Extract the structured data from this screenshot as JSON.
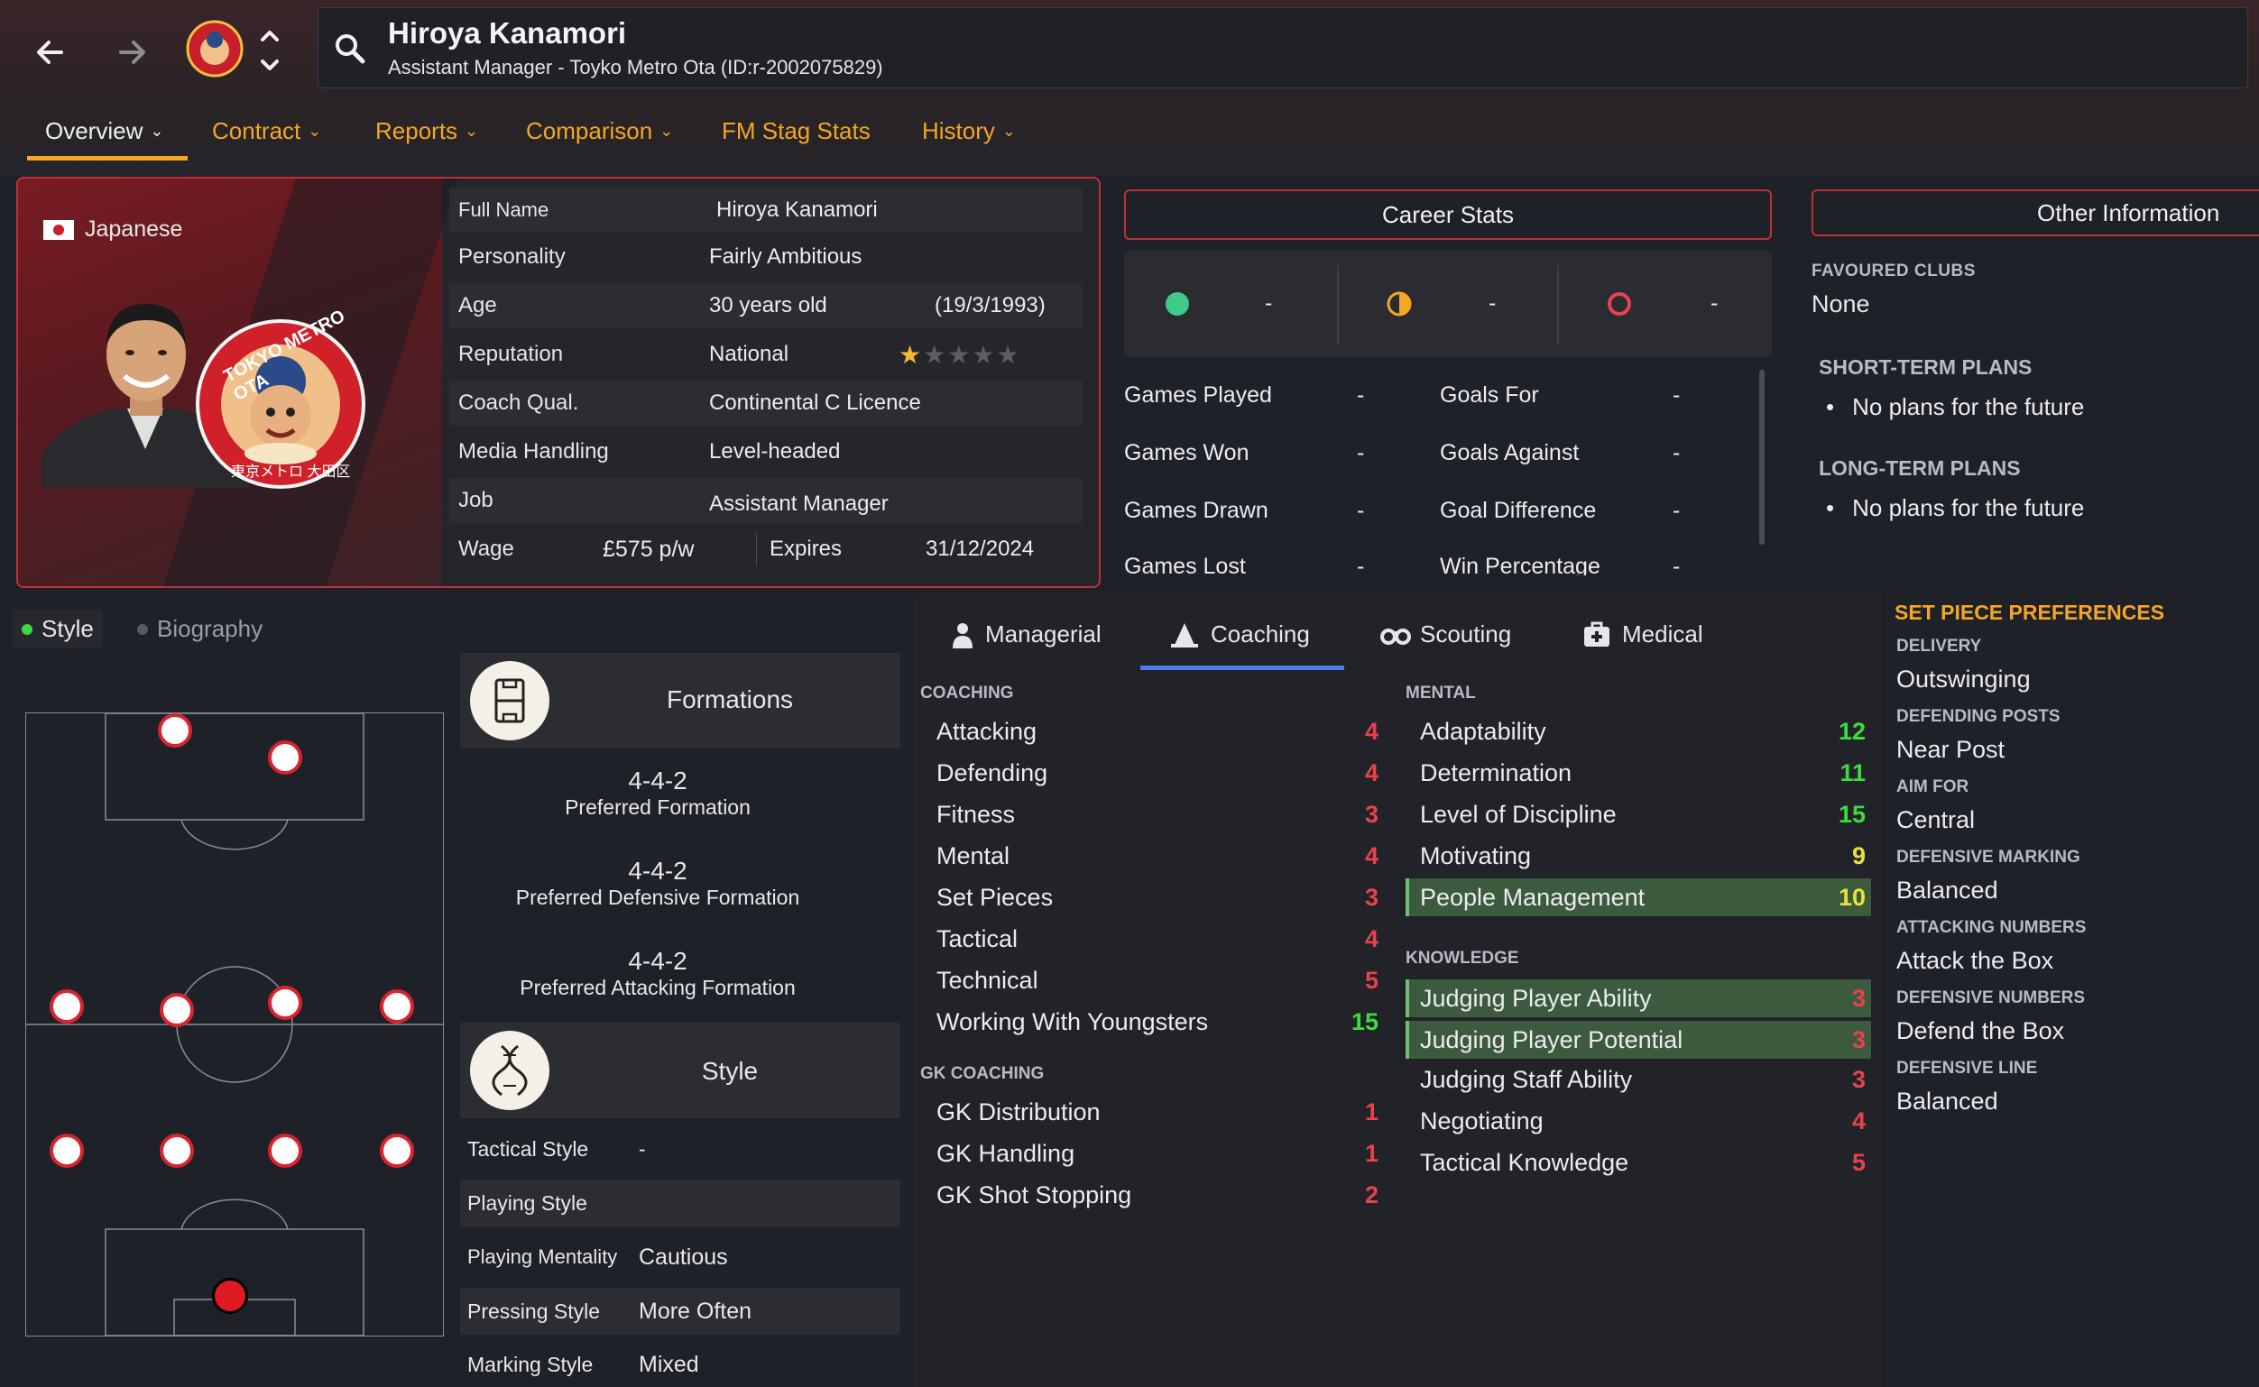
{
  "header": {
    "back_label": "Back",
    "forward_label": "Forward",
    "name": "Hiroya Kanamori",
    "subtitle": "Assistant Manager - Toyko Metro Ota (ID:r-2002075829)",
    "tabs": [
      {
        "label": "Overview",
        "has_menu": true
      },
      {
        "label": "Contract",
        "has_menu": true
      },
      {
        "label": "Reports",
        "has_menu": true
      },
      {
        "label": "Comparison",
        "has_menu": true
      },
      {
        "label": "FM Stag Stats",
        "has_menu": false
      },
      {
        "label": "History",
        "has_menu": true
      }
    ]
  },
  "profile": {
    "nationality": "Japanese",
    "badge_text_top": "TOKYO METRO OTA",
    "badge_text_bottom": "東京メトロ 大田区",
    "full_name_label": "Full Name",
    "full_name": "Hiroya Kanamori",
    "personality_label": "Personality",
    "personality": "Fairly Ambitious",
    "age_label": "Age",
    "age": "30 years old",
    "dob": "(19/3/1993)",
    "reputation_label": "Reputation",
    "reputation": "National",
    "reputation_stars": 1,
    "reputation_stars_max": 5,
    "coach_qual_label": "Coach Qual.",
    "coach_qual": "Continental C Licence",
    "media_label": "Media Handling",
    "media": "Level-headed",
    "job_label": "Job",
    "job": "Assistant Manager",
    "wage_label": "Wage",
    "wage": "£575 p/w",
    "expires_label": "Expires",
    "expires": "31/12/2024"
  },
  "career": {
    "title": "Career Stats",
    "icon_values": [
      "-",
      "-",
      "-"
    ],
    "rows": [
      {
        "l1": "Games Played",
        "v1": "-",
        "l2": "Goals For",
        "v2": "-"
      },
      {
        "l1": "Games Won",
        "v1": "-",
        "l2": "Goals Against",
        "v2": "-"
      },
      {
        "l1": "Games Drawn",
        "v1": "-",
        "l2": "Goal Difference",
        "v2": "-"
      },
      {
        "l1": "Games Lost",
        "v1": "-",
        "l2": "Win Percentage",
        "v2": "-"
      }
    ]
  },
  "other": {
    "title": "Other Information",
    "favoured_clubs_label": "FAVOURED CLUBS",
    "favoured_clubs": "None",
    "short_term_label": "SHORT-TERM PLANS",
    "short_term": "No plans for the future",
    "long_term_label": "LONG-TERM PLANS",
    "long_term": "No plans for the future"
  },
  "lower_tabs": {
    "style": "Style",
    "biography": "Biography"
  },
  "formations": {
    "title": "Formations",
    "items": [
      {
        "value": "4-4-2",
        "label": "Preferred Formation"
      },
      {
        "value": "4-4-2",
        "label": "Preferred Defensive Formation"
      },
      {
        "value": "4-4-2",
        "label": "Preferred Attacking Formation"
      }
    ]
  },
  "style": {
    "title": "Style",
    "rows": [
      {
        "label": "Tactical Style",
        "value": "-"
      },
      {
        "label": "Playing Style",
        "value": ""
      },
      {
        "label": "Playing Mentality",
        "value": "Cautious"
      },
      {
        "label": "Pressing Style",
        "value": "More Often"
      },
      {
        "label": "Marking Style",
        "value": "Mixed"
      }
    ]
  },
  "attr_tabs": [
    "Managerial",
    "Coaching",
    "Scouting",
    "Medical"
  ],
  "coaching": {
    "head": "COACHING",
    "items": [
      {
        "name": "Attacking",
        "value": "4"
      },
      {
        "name": "Defending",
        "value": "4"
      },
      {
        "name": "Fitness",
        "value": "3"
      },
      {
        "name": "Mental",
        "value": "4"
      },
      {
        "name": "Set Pieces",
        "value": "3"
      },
      {
        "name": "Tactical",
        "value": "4"
      },
      {
        "name": "Technical",
        "value": "5"
      },
      {
        "name": "Working With Youngsters",
        "value": "15"
      }
    ],
    "gk_head": "GK COACHING",
    "gk_items": [
      {
        "name": "GK Distribution",
        "value": "1"
      },
      {
        "name": "GK Handling",
        "value": "1"
      },
      {
        "name": "GK Shot Stopping",
        "value": "2"
      }
    ]
  },
  "mental": {
    "head": "MENTAL",
    "items": [
      {
        "name": "Adaptability",
        "value": "12"
      },
      {
        "name": "Determination",
        "value": "11"
      },
      {
        "name": "Level of Discipline",
        "value": "15"
      },
      {
        "name": "Motivating",
        "value": "9"
      },
      {
        "name": "People Management",
        "value": "10"
      }
    ],
    "knowledge_head": "KNOWLEDGE",
    "knowledge_items": [
      {
        "name": "Judging Player Ability",
        "value": "3"
      },
      {
        "name": "Judging Player Potential",
        "value": "3"
      },
      {
        "name": "Judging Staff Ability",
        "value": "3"
      },
      {
        "name": "Negotiating",
        "value": "4"
      },
      {
        "name": "Tactical Knowledge",
        "value": "5"
      }
    ]
  },
  "set_piece": {
    "title": "SET PIECE PREFERENCES",
    "items": [
      {
        "label": "DELIVERY",
        "value": "Outswinging"
      },
      {
        "label": "DEFENDING POSTS",
        "value": "Near Post"
      },
      {
        "label": "AIM FOR",
        "value": "Central"
      },
      {
        "label": "DEFENSIVE MARKING",
        "value": "Balanced"
      },
      {
        "label": "ATTACKING NUMBERS",
        "value": "Attack the Box"
      },
      {
        "label": "DEFENSIVE NUMBERS",
        "value": "Defend the Box"
      },
      {
        "label": "DEFENSIVE LINE",
        "value": "Balanced"
      }
    ]
  },
  "colors": {
    "accent": "#f5a623",
    "brand_red": "#c0303a",
    "green": "#3ddc3d",
    "red": "#e8424c",
    "yellow": "#e8e23a"
  }
}
